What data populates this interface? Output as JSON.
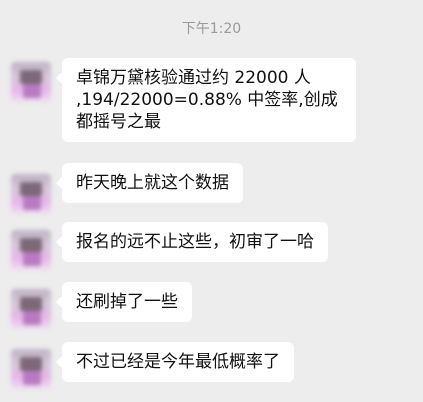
{
  "chat": {
    "timestamp": "下午1:20",
    "messages": [
      {
        "text": "卓锦万黛核验通过约 22000 人 ,194/22000=0.88% 中签率,创成都摇号之最"
      },
      {
        "text": "昨天晚上就这个数据"
      },
      {
        "text": "报名的远不止这些，初审了一哈"
      },
      {
        "text": "还刷掉了一些"
      },
      {
        "text": "不过已经是今年最低概率了"
      }
    ]
  }
}
